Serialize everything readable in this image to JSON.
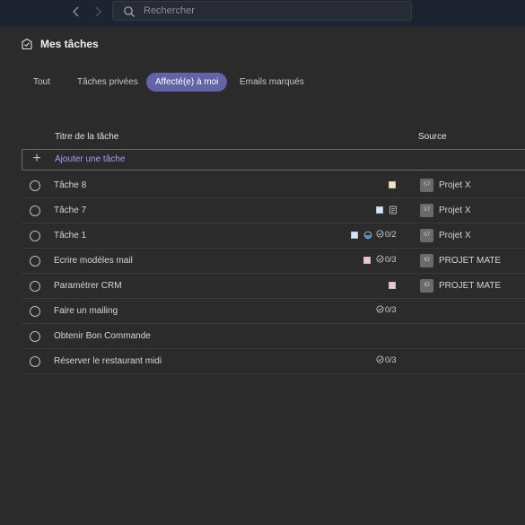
{
  "search": {
    "placeholder": "Rechercher"
  },
  "header": {
    "title": "Mes tâches"
  },
  "tabs": [
    {
      "label": "Tout",
      "active": false
    },
    {
      "label": "Tâches privées",
      "active": false
    },
    {
      "label": "Affecté(e) à moi",
      "active": true
    },
    {
      "label": "Emails marqués",
      "active": false
    }
  ],
  "columns": {
    "title": "Titre de la tâche",
    "source": "Source"
  },
  "add_task": {
    "label": "Ajouter une tâche"
  },
  "tasks": [
    {
      "title": "Tâche 8",
      "label_color": "#f6e7a6",
      "note": false,
      "progress": false,
      "checklist": "",
      "source_icon": "S7",
      "source": "Projet X"
    },
    {
      "title": "Tâche 7",
      "label_color": "#cfe6fb",
      "note": true,
      "progress": false,
      "checklist": "",
      "source_icon": "S7",
      "source": "Projet X"
    },
    {
      "title": "Tâche 1",
      "label_color": "#cfe6fb",
      "note": false,
      "progress": true,
      "checklist": "0/2",
      "source_icon": "S7",
      "source": "Projet X"
    },
    {
      "title": "Ecrire modèles mail",
      "label_color": "#f3c2c8",
      "note": false,
      "progress": false,
      "checklist": "0/3",
      "source_icon": "IO",
      "source": "PROJET MATE"
    },
    {
      "title": "Paramétrer CRM",
      "label_color": "#f3c2c8",
      "note": false,
      "progress": false,
      "checklist": "",
      "source_icon": "IO",
      "source": "PROJET MATE"
    },
    {
      "title": "Faire un mailing",
      "label_color": "",
      "note": false,
      "progress": false,
      "checklist": "0/3",
      "source_icon": "",
      "source": ""
    },
    {
      "title": "Obtenir Bon Commande",
      "label_color": "",
      "note": false,
      "progress": false,
      "checklist": "",
      "source_icon": "",
      "source": ""
    },
    {
      "title": "Réserver le restaurant midi",
      "label_color": "",
      "note": false,
      "progress": false,
      "checklist": "0/3",
      "source_icon": "",
      "source": ""
    }
  ]
}
